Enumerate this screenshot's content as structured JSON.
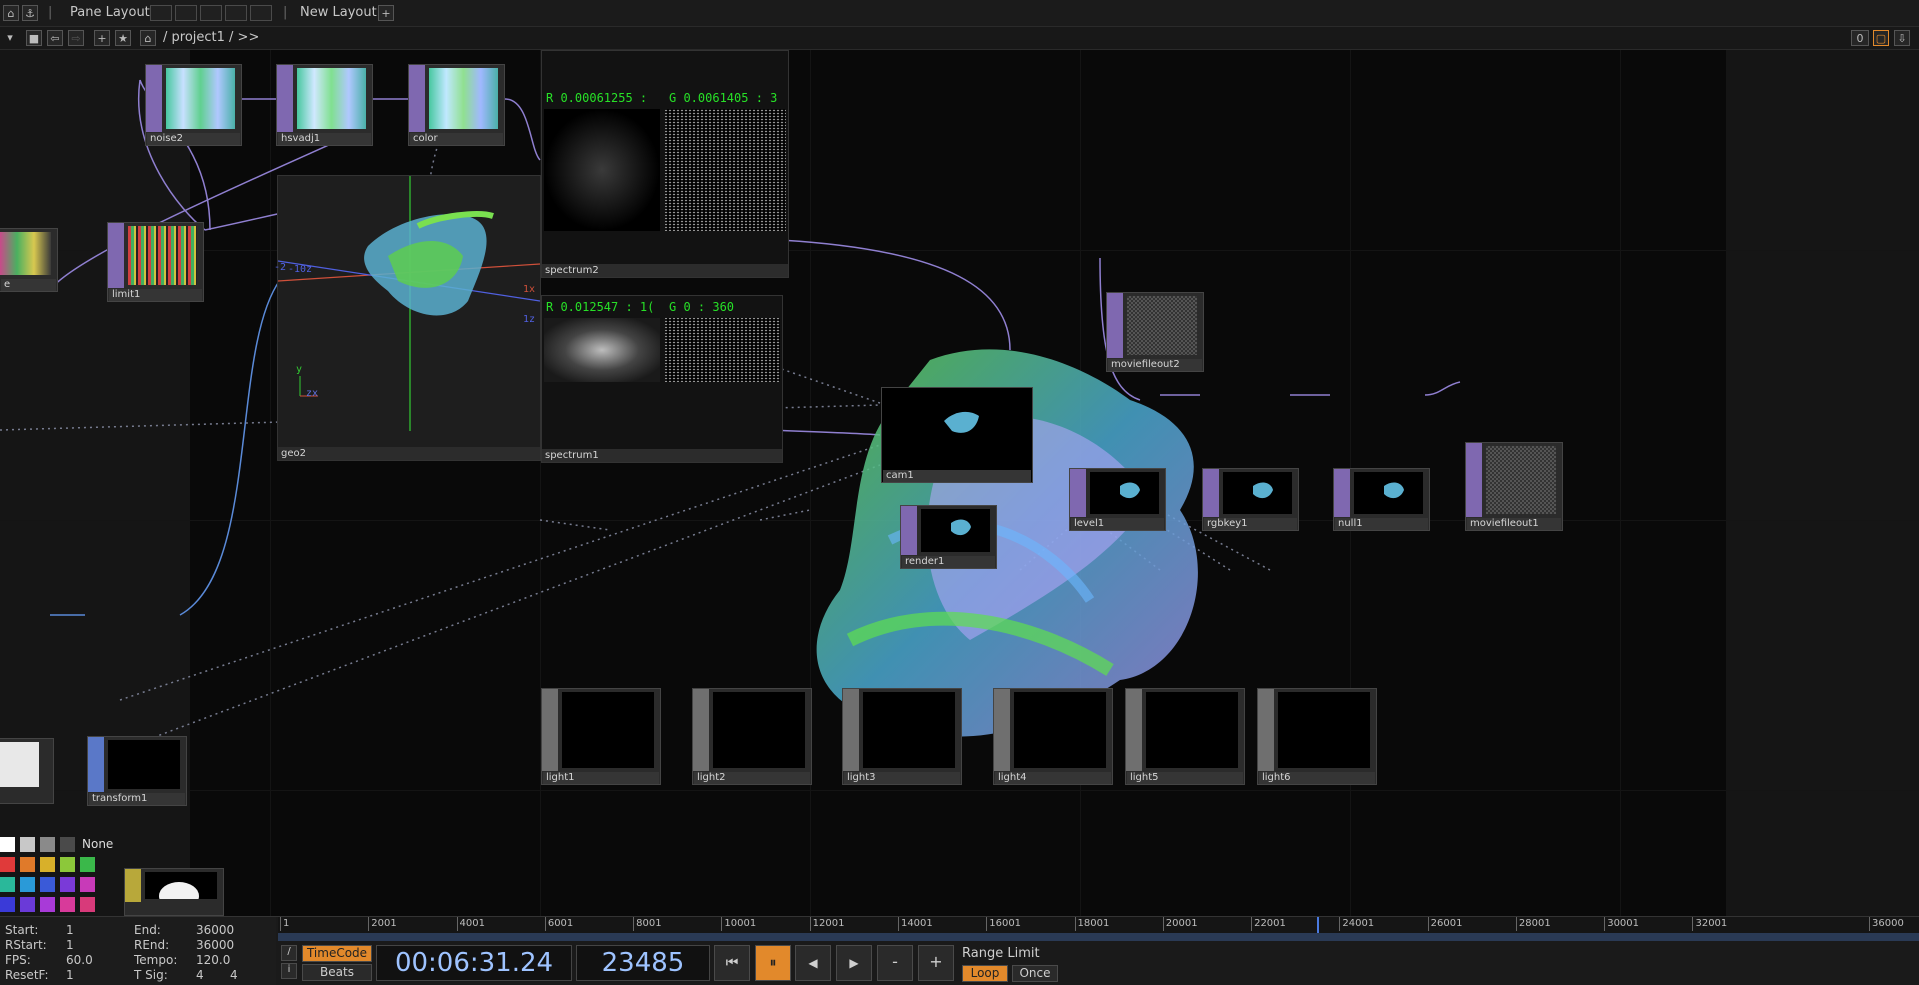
{
  "topbar": {
    "pane_layout_label": "Pane Layout",
    "new_layout_label": "New Layout",
    "add_symbol": "+"
  },
  "pathbar": {
    "path": "/ project1 / >>",
    "counter": "0"
  },
  "operators": {
    "noise2": "noise2",
    "hsvadj1": "hsvadj1",
    "color": "color",
    "limit1": "limit1",
    "left_partial": "e",
    "transform1": "transform1",
    "moviefileout2": "moviefileout2",
    "cam1": "cam1",
    "render1": "render1",
    "level1": "level1",
    "rgbkey1": "rgbkey1",
    "null1": "null1",
    "moviefileout1": "moviefileout1",
    "light1": "light1",
    "light2": "light2",
    "light3": "light3",
    "light4": "light4",
    "light5": "light5",
    "light6": "light6"
  },
  "viewers": {
    "geo2": {
      "name": "geo2",
      "axis_x": "1x",
      "axis_z": "1z",
      "axis_neg": "-10z",
      "axis_neg2": "-2",
      "gizmo_y": "y",
      "gizmo_zx": "zx"
    },
    "spectrum2": {
      "name": "spectrum2",
      "readout_r": "R 0.00061255 :",
      "readout_g": "G 0.0061405 : 3"
    },
    "spectrum1": {
      "name": "spectrum1",
      "readout_r": "R 0.012547 : 1(",
      "readout_g": "G 0 : 360"
    }
  },
  "palette": {
    "none_label": "None",
    "colors": [
      "#ffffff",
      "#c8c8c8",
      "#8a8a8a",
      "#4a4a4a",
      "#222222",
      "#e03a3a",
      "#e07a2a",
      "#d8b02a",
      "#8cc83a",
      "#3ab84a",
      "#2ab89a",
      "#2a9ad8",
      "#3a5ad8",
      "#7a3ad8",
      "#c83ab8",
      "#d83a7a"
    ]
  },
  "timeinfo": {
    "start_label": "Start:",
    "start_value": "1",
    "rstart_label": "RStart:",
    "rstart_value": "1",
    "fps_label": "FPS:",
    "fps_value": "60.0",
    "resetf_label": "ResetF:",
    "resetf_value": "1",
    "end_label": "End:",
    "end_value": "36000",
    "rend_label": "REnd:",
    "rend_value": "36000",
    "tempo_label": "Tempo:",
    "tempo_value": "120.0",
    "tsig_label": "T Sig:",
    "tsig_value1": "4",
    "tsig_value2": "4"
  },
  "timeline": {
    "ticks": [
      "1",
      "2001",
      "4001",
      "6001",
      "8001",
      "10001",
      "12001",
      "14001",
      "16001",
      "18001",
      "20001",
      "22001",
      "24001",
      "26001",
      "28001",
      "30001",
      "32001",
      "36000"
    ],
    "playhead_frame": 23485,
    "range_start": 1,
    "range_end": 36000
  },
  "transport": {
    "timecode_label": "TimeCode",
    "beats_label": "Beats",
    "timecode": "00:06:31.24",
    "frame": "23485",
    "minus": "-",
    "plus": "+",
    "range_limit_label": "Range Limit",
    "loop_label": "Loop",
    "once_label": "Once"
  },
  "colors": {
    "accent_orange": "#e2892b",
    "top_purple": "#7f68b0",
    "sop_blue": "#5a78c8",
    "chop_red": "#9b3a5f",
    "readout_green": "#27e027"
  }
}
